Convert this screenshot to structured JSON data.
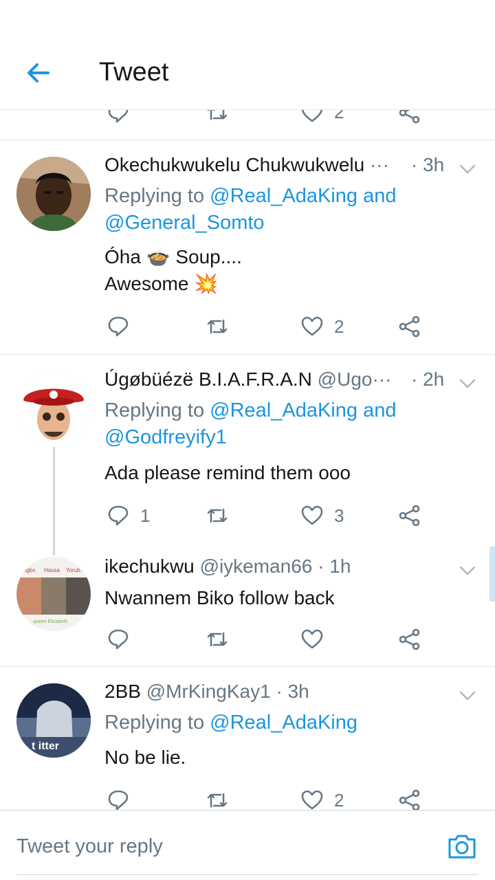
{
  "header": {
    "title": "Tweet"
  },
  "colors": {
    "accent": "#1b95e0",
    "muted": "#657786",
    "divider": "#e1e8ed"
  },
  "partial_actions": {
    "like_count": "2"
  },
  "tweets": [
    {
      "name": "Okechukwukelu Chukwukwelu",
      "handle": "···",
      "time": "· 3h",
      "replying_prefix": "Replying to ",
      "mentions": [
        "@Real_AdaKing",
        "@General_Somto"
      ],
      "joiner": " and",
      "body": [
        "Óha 🍲 Soup....",
        "Awesome 💥"
      ],
      "replies": "",
      "retweets": "",
      "likes": "2"
    },
    {
      "name": "Úgøbüézë B.I.A.F.R.A.N",
      "handle": "@Ugo···",
      "time": "· 2h",
      "replying_prefix": "Replying to ",
      "mentions": [
        "@Real_AdaKing",
        "@Godfreyify1"
      ],
      "joiner": " and",
      "body": [
        "Ada please remind them ooo"
      ],
      "replies": "1",
      "retweets": "",
      "likes": "3"
    },
    {
      "name": "ikechukwu",
      "handle": "@iykeman66",
      "time": "· 1h",
      "body": [
        "Nwannem Biko follow back"
      ],
      "avatar_labels": [
        "Igbo",
        "Hausa",
        "Yorub.",
        "queen Elizabeth"
      ],
      "replies": "",
      "retweets": "",
      "likes": ""
    },
    {
      "name": "2BB",
      "handle": "@MrKingKay1",
      "time": "· 3h",
      "replying_prefix": "Replying to ",
      "mentions": [
        "@Real_AdaKing"
      ],
      "body": [
        "No be lie."
      ],
      "avatar_label": "t  itter",
      "replies": "",
      "retweets": "",
      "likes": "2"
    }
  ],
  "compose": {
    "placeholder": "Tweet your reply"
  }
}
